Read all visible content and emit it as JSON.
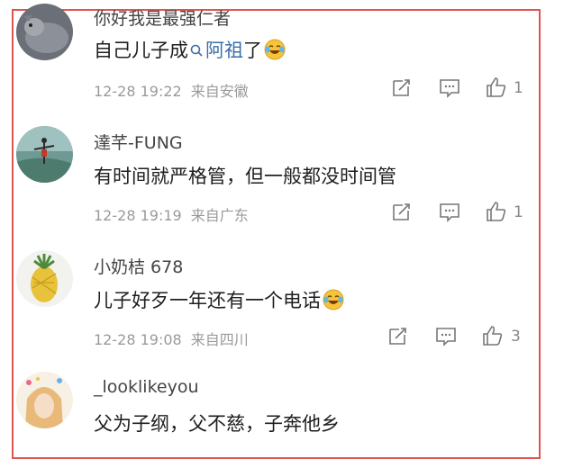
{
  "comments": [
    {
      "username": "你好我是最强仁者",
      "text_before": "自己儿子成",
      "link_text": "阿祖",
      "text_after": "了",
      "emoji": "laugh-cry-emoji",
      "time": "12-28 19:22",
      "source": "来自安徽",
      "likes": "1"
    },
    {
      "username": "達芊-FUNG",
      "text": "有时间就严格管，但一般都没时间管",
      "time": "12-28 19:19",
      "source": "来自广东",
      "likes": "1"
    },
    {
      "username": "小奶桔 678",
      "text": "儿子好歹一年还有一个电话",
      "emoji": "laugh-cry-emoji",
      "time": "12-28 19:08",
      "source": "来自四川",
      "likes": "3"
    },
    {
      "username": "_looklikeyou",
      "text": "父为子纲，父不慈，子奔他乡"
    }
  ],
  "icons": {
    "edit": "edit-icon",
    "comment": "comment-icon",
    "like": "thumbs-up-icon"
  },
  "colors": {
    "highlight_frame": "#e0534f",
    "link": "#3a6ea8",
    "meta_text": "#9a9a9a"
  }
}
